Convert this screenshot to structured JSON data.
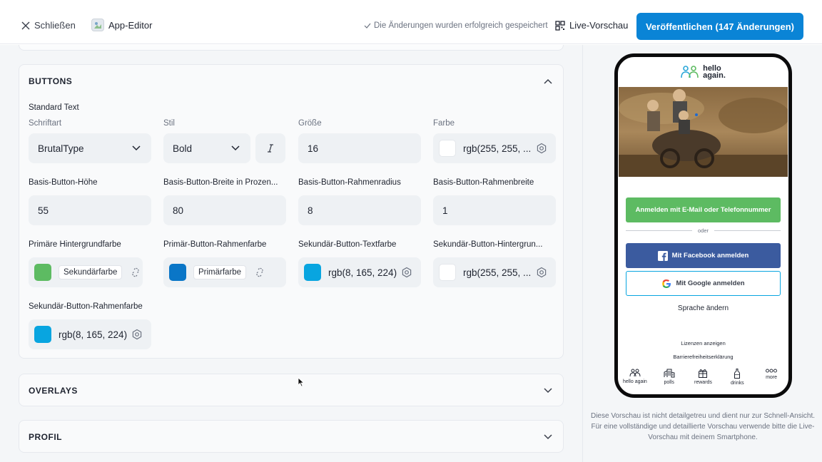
{
  "topbar": {
    "close_label": "Schließen",
    "app_editor_label": "App-Editor",
    "saved_text": "Die Änderungen wurden erfolgreich gespeichert",
    "live_preview_label": "Live-Vorschau",
    "publish_label": "Veröffentlichen (147 Änderungen)"
  },
  "colors": {
    "accent": "#0a84d6",
    "green": "#5dbb62",
    "primary_blue": "#0a76c7",
    "secondary_blue": "#08a5e0",
    "facebook": "#3b5b9f"
  },
  "buttons_section": {
    "title": "BUTTONS",
    "standard_text": "Standard Text",
    "font_label": "Schriftart",
    "font_value": "BrutalType",
    "style_label": "Stil",
    "style_value": "Bold",
    "size_label": "Größe",
    "size_value": "16",
    "color_label": "Farbe",
    "color_value": "rgb(255, 255, ...",
    "height_label": "Basis-Button-Höhe",
    "height_value": "55",
    "width_label": "Basis-Button-Breite in Prozen...",
    "width_value": "80",
    "radius_label": "Basis-Button-Rahmenradius",
    "radius_value": "8",
    "border_width_label": "Basis-Button-Rahmenbreite",
    "border_width_value": "1",
    "primary_bg_label": "Primäre Hintergrundfarbe",
    "primary_bg_chip": "Sekundärfarbe",
    "primary_border_label": "Primär-Button-Rahmenfarbe",
    "primary_border_chip": "Primärfarbe",
    "secondary_text_label": "Sekundär-Button-Textfarbe",
    "secondary_text_value": "rgb(8, 165, 224)",
    "secondary_bg_label": "Sekundär-Button-Hintergrun...",
    "secondary_bg_value": "rgb(255, 255, ...",
    "secondary_border_label": "Sekundär-Button-Rahmenfarbe",
    "secondary_border_value": "rgb(8, 165, 224)"
  },
  "overlays_section": {
    "title": "OVERLAYS"
  },
  "profile_section": {
    "title": "PROFIL"
  },
  "phone": {
    "logo_line1": "hello",
    "logo_line2": "again.",
    "email_btn": "Anmelden mit E-Mail oder Telefonnummer",
    "or_text": "oder",
    "facebook_btn": "Mit Facebook anmelden",
    "google_btn": "Mit Google anmelden",
    "language": "Sprache ändern",
    "licenses": "Lizenzen anzeigen",
    "accessibility": "Barrierefreiheitserklärung",
    "nav": [
      {
        "label": "hello again",
        "icon": "people-icon"
      },
      {
        "label": "polls",
        "icon": "city-icon"
      },
      {
        "label": "rewards",
        "icon": "gift-icon"
      },
      {
        "label": "drinks",
        "icon": "bottle-icon"
      },
      {
        "label": "more",
        "icon": "more-dots-icon"
      }
    ]
  },
  "disclaimer": "Diese Vorschau ist nicht detailgetreu und dient nur zur Schnell-Ansicht. Für eine vollständige und detaillierte Vorschau verwende bitte die Live-Vorschau mit deinem Smartphone."
}
